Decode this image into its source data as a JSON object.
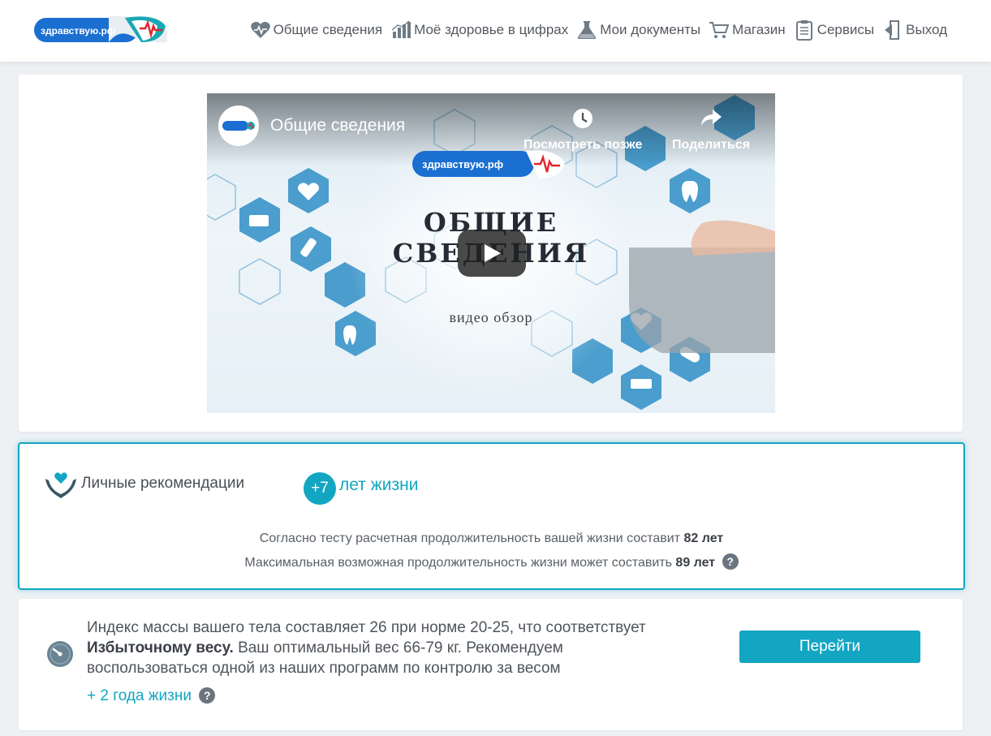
{
  "header": {
    "logo_text": "здравствую.рф",
    "nav": [
      {
        "label": "Общие сведения",
        "icon": "heart-icon"
      },
      {
        "label": "Моё здоровье в цифрах",
        "icon": "bar-chart-icon"
      },
      {
        "label": "Мои документы",
        "icon": "flask-icon"
      },
      {
        "label": "Магазин",
        "icon": "cart-icon"
      },
      {
        "label": "Сервисы",
        "icon": "clipboard-icon"
      },
      {
        "label": "Выход",
        "icon": "exit-icon"
      }
    ]
  },
  "video": {
    "title": "Общие сведения",
    "watch_later": "Посмотреть позже",
    "share": "Поделиться",
    "logo_text": "здравствую.рф",
    "heading_line1": "ОБЩИЕ",
    "heading_line2": "СВЕДЕНИЯ",
    "subtitle": "видео обзор"
  },
  "recommendations": {
    "title": "Личные рекомендации",
    "plus_value": "+7",
    "plus_label": "лет жизни",
    "line1_prefix": "Согласно тесту расчетная продолжительность вашей жизни составит",
    "line1_value": "82 лет",
    "line2_prefix": "Максимальная возможная продолжительность жизни может составить",
    "line2_value": "89 лет",
    "help_symbol": "?"
  },
  "bmi": {
    "text_before": "Индекс массы вашего тела составляет 26 при норме 20-25, что соответствует",
    "text_bold": "Избыточному весу.",
    "text_after": "Ваш оптимальный вес 66-79 кг. Рекомендуем воспользоваться одной из наших программ по контролю за весом",
    "years_label": "+ 2 года жизни",
    "help_symbol": "?",
    "button_label": "Перейти"
  },
  "colors": {
    "accent": "#12a6c2",
    "logo_blue": "#1a6fd1",
    "heart_red": "#e0252b"
  }
}
